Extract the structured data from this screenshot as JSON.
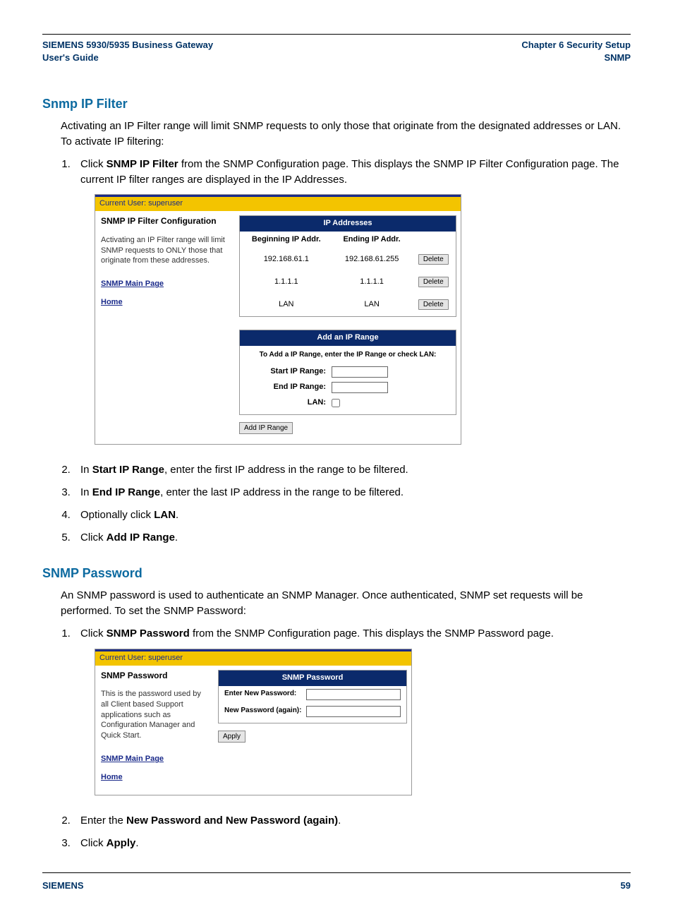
{
  "header": {
    "left_line1": "SIEMENS 5930/5935 Business Gateway",
    "left_line2": "User's Guide",
    "right_line1": "Chapter 6  Security Setup",
    "right_line2": "SNMP"
  },
  "sec1": {
    "title": "Snmp IP Filter",
    "intro": "Activating an IP Filter range will limit SNMP requests to only those that originate from the designated addresses or LAN. To activate IP filtering:",
    "step1_pre": "Click ",
    "step1_bold": "SNMP IP Filter",
    "step1_post": " from the SNMP Configuration page. This displays the SNMP IP Filter Configuration page. The current IP filter ranges are displayed in the IP Addresses.",
    "step2_pre": "In ",
    "step2_bold": "Start IP Range",
    "step2_post": ", enter the first IP address in the range to be filtered.",
    "step3_pre": "In ",
    "step3_bold": "End IP Range",
    "step3_post": ", enter the last IP address in the range to be filtered.",
    "step4_pre": "Optionally click ",
    "step4_bold": "LAN",
    "step4_post": ".",
    "step5_pre": "Click ",
    "step5_bold": "Add IP Range",
    "step5_post": "."
  },
  "ss1": {
    "user": "Current User: superuser",
    "title": "SNMP IP Filter Configuration",
    "desc": "Activating an IP Filter range will limit SNMP requests to ONLY those that originate from these addresses.",
    "link1": "SNMP Main Page",
    "link2": "Home",
    "tbl_hdr": "IP Addresses",
    "col1": "Beginning IP Addr.",
    "col2": "Ending IP Addr.",
    "rows": [
      {
        "a": "192.168.61.1",
        "b": "192.168.61.255"
      },
      {
        "a": "1.1.1.1",
        "b": "1.1.1.1"
      },
      {
        "a": "LAN",
        "b": "LAN"
      }
    ],
    "del_btn": "Delete",
    "add_hdr": "Add an IP Range",
    "add_note": "To Add a IP Range, enter the IP Range or check LAN:",
    "lbl_start": "Start IP Range:",
    "lbl_end": "End IP Range:",
    "lbl_lan": "LAN:",
    "add_btn": "Add IP Range"
  },
  "sec2": {
    "title": "SNMP Password",
    "intro": "An SNMP password is used to authenticate an SNMP Manager. Once authenticated, SNMP set requests will be performed. To set the SNMP Password:",
    "step1_pre": "Click ",
    "step1_bold": "SNMP Password",
    "step1_post": " from the SNMP Configuration page. This displays the SNMP Password page.",
    "step2_pre": "Enter the ",
    "step2_bold": "New Password and New Password (again)",
    "step2_post": ".",
    "step3_pre": "Click ",
    "step3_bold": "Apply",
    "step3_post": "."
  },
  "ss2": {
    "user": "Current User: superuser",
    "title": "SNMP Password",
    "desc": "This is the password used by all Client based Support applications such as Configuration Manager and Quick Start.",
    "link1": "SNMP Main Page",
    "link2": "Home",
    "hdr": "SNMP Password",
    "lbl_new": "Enter New Password:",
    "lbl_again": "New Password (again):",
    "apply_btn": "Apply"
  },
  "footer": {
    "left": "SIEMENS",
    "right": "59"
  }
}
